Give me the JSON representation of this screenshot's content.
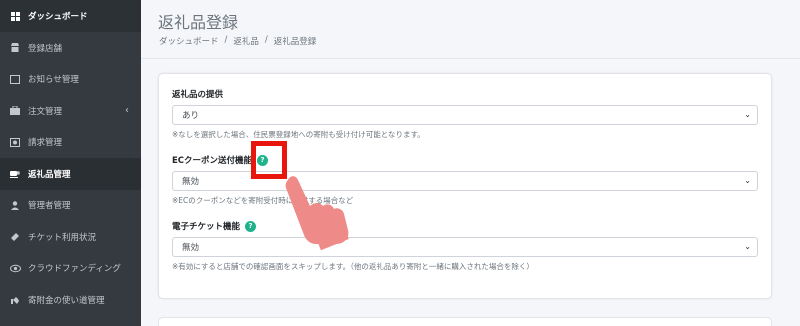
{
  "sidebar": {
    "items": [
      {
        "label": "ダッシュボード",
        "icon": "grid-icon"
      },
      {
        "label": "登録店舗",
        "icon": "store-icon"
      },
      {
        "label": "お知らせ管理",
        "icon": "notice-icon"
      },
      {
        "label": "注文管理",
        "icon": "cart-icon",
        "chevron": "‹"
      },
      {
        "label": "請求管理",
        "icon": "bill-icon"
      },
      {
        "label": "返礼品管理",
        "icon": "gift-icon"
      },
      {
        "label": "管理者管理",
        "icon": "user-icon"
      },
      {
        "label": "チケット利用状況",
        "icon": "ticket-icon"
      },
      {
        "label": "クラウドファンディング",
        "icon": "eye-icon"
      },
      {
        "label": "寄附金の使い道管理",
        "icon": "hand-icon"
      }
    ]
  },
  "header": {
    "title": "返礼品登録",
    "breadcrumb": [
      "ダッシュボード",
      "返礼品",
      "返礼品登録"
    ],
    "sep": "/"
  },
  "form": {
    "provide": {
      "label": "返礼品の提供",
      "value": "あり",
      "help": "※なしを選択した場合、住民票登録地への寄附も受け付け可能となります。"
    },
    "ec_coupon": {
      "label": "ECクーポン送付機能",
      "value": "無効",
      "help": "※ECのクーポンなどを寄附受付時に送付する場合など"
    },
    "e_ticket": {
      "label": "電子チケット機能",
      "value": "無効",
      "help": "※有効にすると店舗での確認画面をスキップします。（他の返礼品あり寄附と一緒に購入された場合を除く）"
    },
    "help_glyph": "?",
    "caret": "⌄"
  },
  "colors": {
    "sidebar_bg": "#343a40",
    "accent_help": "#20b28a",
    "highlight": "#e8160c",
    "hand": "#ee8a88"
  }
}
